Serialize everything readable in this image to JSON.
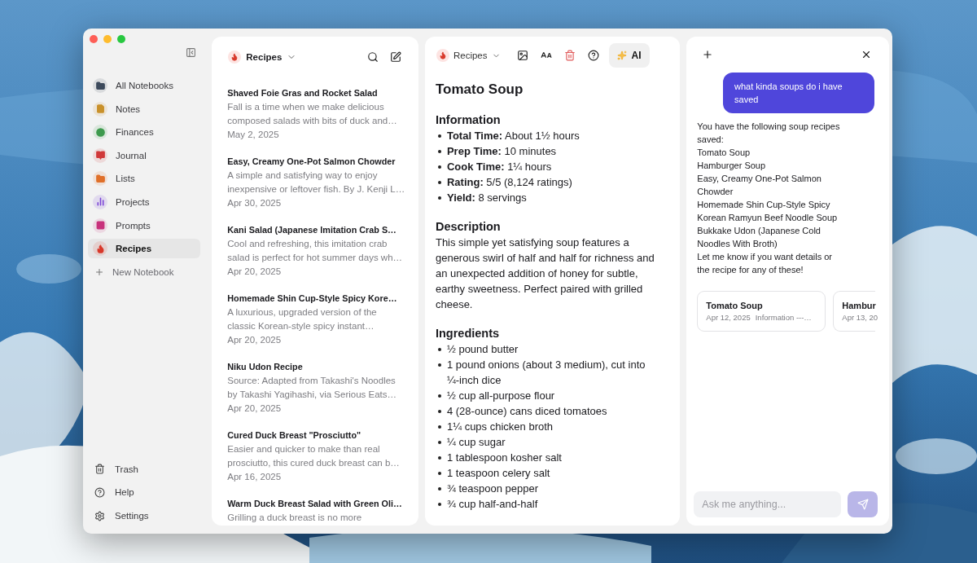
{
  "sidebar": {
    "notebooks": [
      {
        "label": "All Notebooks",
        "color": "#3d4a5c",
        "selected": false
      },
      {
        "label": "Notes",
        "color": "#c9912b",
        "selected": false
      },
      {
        "label": "Finances",
        "color": "#3e9a4e",
        "selected": false
      },
      {
        "label": "Journal",
        "color": "#d0393a",
        "selected": false
      },
      {
        "label": "Lists",
        "color": "#e0702a",
        "selected": false
      },
      {
        "label": "Projects",
        "color": "#7b45d6",
        "selected": false
      },
      {
        "label": "Prompts",
        "color": "#c8327c",
        "selected": false
      },
      {
        "label": "Recipes",
        "color": "#d8392b",
        "selected": true
      }
    ],
    "new_notebook": "New Notebook",
    "footer": [
      {
        "label": "Trash"
      },
      {
        "label": "Help"
      },
      {
        "label": "Settings"
      }
    ]
  },
  "note_list": {
    "notebook": "Recipes",
    "notes": [
      {
        "title": "Shaved Foie Gras and Rocket Salad",
        "snippet": "Fall is a time when we make delicious composed salads with bits of duck and…",
        "date": "May 2, 2025"
      },
      {
        "title": "Easy, Creamy One-Pot Salmon Chowder",
        "snippet": "A simple and satisfying way to enjoy inexpensive or leftover fish. By J. Kenji L…",
        "date": "Apr 30, 2025"
      },
      {
        "title": "Kani Salad (Japanese Imitation Crab S…",
        "snippet": "Cool and refreshing, this imitation crab salad is perfect for hot summer days wh…",
        "date": "Apr 20, 2025"
      },
      {
        "title": "Homemade Shin Cup-Style Spicy Kore…",
        "snippet": "A luxurious, upgraded version of the classic Korean-style spicy instant…",
        "date": "Apr 20, 2025"
      },
      {
        "title": "Niku Udon Recipe",
        "snippet": "Source: Adapted from Takashi's Noodles by Takashi Yagihashi, via Serious Eats…",
        "date": "Apr 20, 2025"
      },
      {
        "title": "Cured Duck Breast \"Prosciutto\"",
        "snippet": "Easier and quicker to make than real prosciutto, this cured duck breast can b…",
        "date": "Apr 16, 2025"
      },
      {
        "title": "Warm Duck Breast Salad with Green Oli…",
        "snippet": "Grilling a duck breast is no more"
      }
    ]
  },
  "editor": {
    "notebook": "Recipes",
    "ai_button": "AI",
    "title": "Tomato Soup",
    "sections": [
      {
        "kind": "list",
        "heading": "Information",
        "items": [
          "**Total Time:** About 1½ hours",
          "**Prep Time:** 10 minutes",
          "**Cook Time:** 1¼ hours",
          "**Rating:** 5/5 (8,124 ratings)",
          "**Yield:** 8 servings"
        ]
      },
      {
        "kind": "paragraph",
        "heading": "Description",
        "text": "This simple yet satisfying soup features a generous swirl of half and half for richness and an unexpected addition of honey for subtle, earthy sweetness. Perfect paired with grilled cheese."
      },
      {
        "kind": "list",
        "heading": "Ingredients",
        "items": [
          "½ pound butter",
          "1 pound onions (about 3 medium), cut into ¼-inch dice",
          "½ cup all-purpose flour",
          "4 (28-ounce) cans diced tomatoes",
          "1¼ cups chicken broth",
          "¼ cup sugar",
          "1 tablespoon kosher salt",
          "1 teaspoon celery salt",
          "¾ teaspoon pepper",
          "¾ cup half-and-half"
        ]
      }
    ]
  },
  "chat": {
    "messages": [
      {
        "kind": "user",
        "lines": [
          "what kinda soups do i have saved"
        ]
      },
      {
        "kind": "assistant",
        "lines": [
          "You have the following soup recipes saved:",
          "Tomato Soup",
          "Hamburger Soup",
          "Easy, Creamy One-Pot Salmon Chowder",
          "Homemade Shin Cup-Style Spicy Korean Ramyun Beef Noodle Soup",
          "Bukkake Udon (Japanese Cold Noodles With Broth)",
          "Let me know if you want details or the recipe for any of these!"
        ]
      }
    ],
    "cards": [
      {
        "title": "Tomato Soup",
        "date": "Apr 12, 2025",
        "preview": "Information ---…"
      },
      {
        "title": "Hambur",
        "date": "Apr 13, 20"
      }
    ],
    "input": {
      "placeholder": "Ask me anything..."
    }
  }
}
